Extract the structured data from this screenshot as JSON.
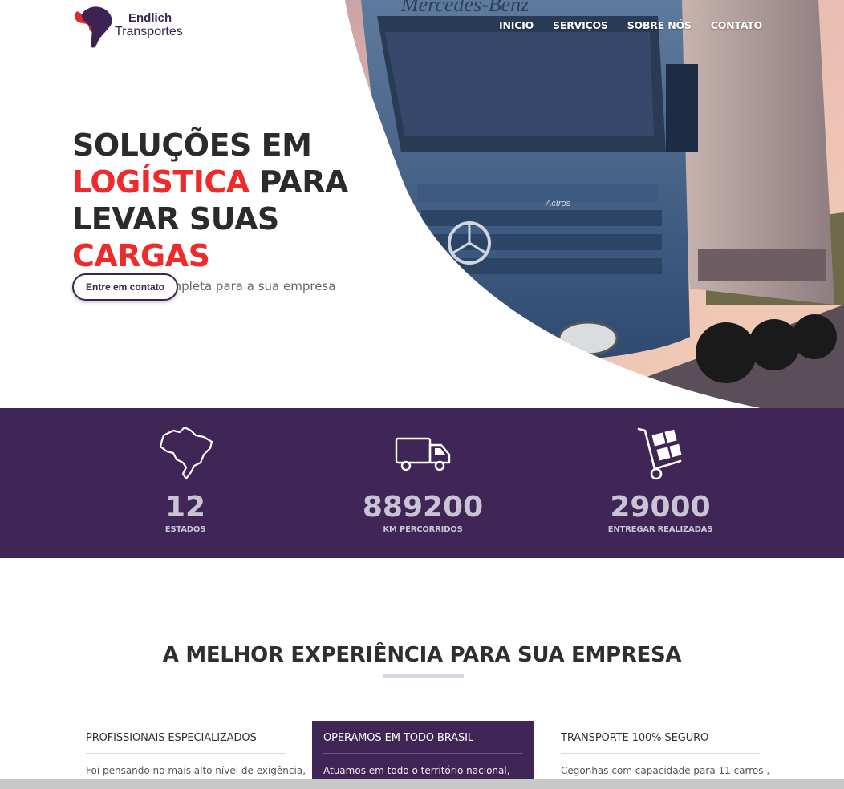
{
  "header": {
    "logo": {
      "name": "Endlich",
      "subtitle": "Transportes"
    },
    "nav": [
      "INICIO",
      "SERVIÇOS",
      "SOBRE NÓS",
      "CONTATO"
    ]
  },
  "hero": {
    "title_line1": "SOLUÇÕES EM",
    "title_line2_red": "LOGÍSTICA",
    "title_line2_rest": " PARA",
    "title_line3_start": "LEVAR SUAS ",
    "title_line3_red": "CARGAS",
    "subtitle": "Nossa frota é completa para a sua empresa",
    "cta_label": "Entre em contato",
    "truck_grille_text": "Mercedes-Benz",
    "truck_badge_text": "Actros"
  },
  "stats": [
    {
      "icon": "brazil-map-icon",
      "value": "12",
      "label": "ESTADOS"
    },
    {
      "icon": "truck-icon",
      "value": "889200",
      "label": "KM PERCORRIDOS"
    },
    {
      "icon": "hand-truck-icon",
      "value": "29000",
      "label": "ENTREGAR REALIZADAS"
    }
  ],
  "experience": {
    "title": "A MELHOR EXPERIÊNCIA PARA SUA EMPRESA",
    "cards": [
      {
        "title": "PROFISSIONAIS ESPECIALIZADOS",
        "text": "Foi pensando no mais alto nível de exigência,"
      },
      {
        "title": "OPERAMOS EM TODO BRASIL",
        "text": "Atuamos em todo o território nacional,"
      },
      {
        "title": "TRANSPORTE 100% SEGURO",
        "text": "Cegonhas com capacidade para 11 carros ,"
      }
    ]
  },
  "colors": {
    "brand_purple": "#3f2656",
    "accent_red": "#ee2a2a"
  }
}
